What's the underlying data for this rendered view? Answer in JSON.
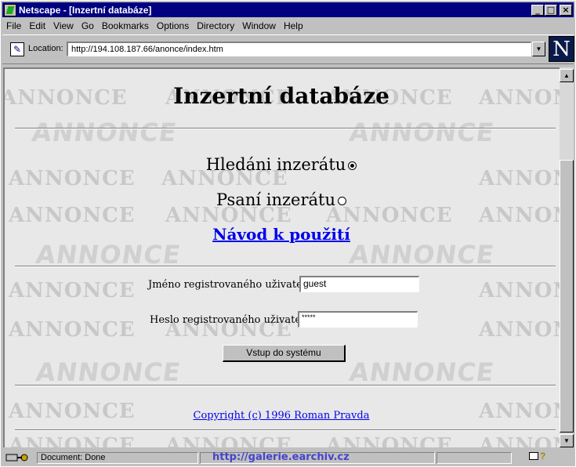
{
  "window": {
    "title": "Netscape - [Inzertní databáze]",
    "controls": [
      "_",
      "□",
      "×"
    ]
  },
  "menu": {
    "items": [
      "File",
      "Edit",
      "View",
      "Go",
      "Bookmarks",
      "Options",
      "Directory",
      "Window",
      "Help"
    ]
  },
  "location": {
    "label": "Location:",
    "url": "http://194.108.187.66/anonce/index.htm"
  },
  "logo": {
    "letter": "N"
  },
  "page": {
    "title": "Inzertní databáze",
    "choice_search": "Hledáni inzerátu",
    "choice_write": "Psaní inzerátu",
    "help_link": "Návod k použití",
    "username_label": "Jméno registrovaného uživatele:",
    "username_value": "guest",
    "password_label": "Heslo registrovaného uživatele:",
    "password_value": "*****",
    "submit_label": "Vstup do systému",
    "copyright": "Copyright (c) 1996 Roman Pravda",
    "watermark": "ANNONCE"
  },
  "status": {
    "text": "Document: Done",
    "overlay_url": "http://galerie.earchiv.cz"
  },
  "colors": {
    "titlebar": "#000080",
    "link": "#0000ee",
    "chrome": "#c0c0c0"
  }
}
